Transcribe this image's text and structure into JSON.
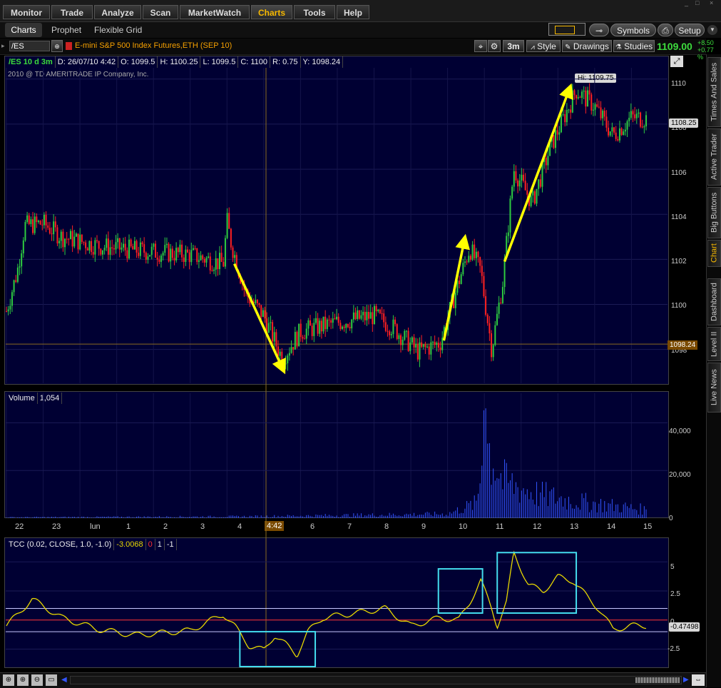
{
  "nav": {
    "tabs": [
      {
        "label": "Monitor"
      },
      {
        "label": "Trade"
      },
      {
        "label": "Analyze"
      },
      {
        "label": "Scan"
      },
      {
        "label": "MarketWatch"
      },
      {
        "label": "Charts"
      },
      {
        "label": "Tools"
      },
      {
        "label": "Help"
      }
    ],
    "active": "Charts"
  },
  "subnav": {
    "tabs": [
      {
        "label": "Charts"
      },
      {
        "label": "Prophet"
      },
      {
        "label": "Flexible Grid"
      }
    ],
    "symbols_label": "Symbols",
    "setup_label": "Setup"
  },
  "chartbar": {
    "symbol": "/ES",
    "description": "E-mini S&P 500 Index Futures,ETH (SEP 10)",
    "aggregation": "3m",
    "style_label": "Style",
    "drawings_label": "Drawings",
    "studies_label": "Studies",
    "last_price": "1109.00",
    "net_change": "+8.50",
    "pct_change": "+0.77 %"
  },
  "price_panel": {
    "header": [
      "/ES 10 d 3m",
      "D: 26/07/10 4:42",
      "O: 1099.5",
      "H: 1100.25",
      "L: 1099.5",
      "C: 1100",
      "R: 0.75",
      "Y: 1098.24"
    ],
    "copyright": "2010 @ TD AMERITRADE IP Company, Inc.",
    "hi_label": "Hi: 1109.75",
    "current_price_label": "1108.25",
    "cursor_price_label": "1098.24",
    "y_ticks": [
      "1110",
      "1108",
      "1106",
      "1104",
      "1102",
      "1100",
      "1098"
    ]
  },
  "volume_panel": {
    "title": "Volume",
    "value": "1,054",
    "y_ticks": [
      "40,000",
      "20,000",
      "0"
    ]
  },
  "time_axis": {
    "labels": [
      "22",
      "23",
      "lun",
      "1",
      "2",
      "3",
      "4",
      "4:42",
      "6",
      "7",
      "8",
      "9",
      "10",
      "11",
      "12",
      "13",
      "14",
      "15"
    ]
  },
  "tcc_panel": {
    "header": [
      "TCC (0.02, CLOSE, 1.0, -1.0)",
      "-3.0068",
      "0",
      "1",
      "-1"
    ],
    "current_label": "-0.47498",
    "y_ticks": [
      "5",
      "2.5",
      "0",
      "-2.5"
    ]
  },
  "sidebar": {
    "tabs": [
      "Times And Sales",
      "Active Trader",
      "Big Buttons",
      "Chart",
      "Dashboard",
      "Level II",
      "Live News"
    ],
    "active": "Chart"
  },
  "colors": {
    "panel_bg": "#000033",
    "accent": "#f6b800",
    "up_bar": "#2ecc40",
    "down_bar": "#ff2020",
    "arrow": "#ffff00",
    "highlight_box": "#44ddee",
    "volume": "#3355ff",
    "tcc_line": "#e8d800",
    "zero_line": "#ff3030",
    "band_line": "#c8c8ff"
  },
  "chart_data": [
    {
      "type": "candlestick",
      "title": "/ES 10 d 3m",
      "ylim": [
        1096.5,
        1110.5
      ],
      "x_labels": [
        "22",
        "23",
        "lun",
        "1",
        "2",
        "3",
        "4",
        "6",
        "7",
        "8",
        "9",
        "10",
        "11",
        "12",
        "13",
        "14",
        "15"
      ],
      "price_path": [
        {
          "t": 0,
          "p": 1099.7
        },
        {
          "t": 0.3,
          "p": 1101.5
        },
        {
          "t": 0.5,
          "p": 1103.5
        },
        {
          "t": 1.0,
          "p": 1103.6
        },
        {
          "t": 1.5,
          "p": 1103.0
        },
        {
          "t": 2.5,
          "p": 1102.6
        },
        {
          "t": 3.5,
          "p": 1102.4
        },
        {
          "t": 5.0,
          "p": 1102.2
        },
        {
          "t": 5.9,
          "p": 1101.8
        },
        {
          "t": 6.0,
          "p": 1103.7
        },
        {
          "t": 6.1,
          "p": 1102.8
        },
        {
          "t": 6.5,
          "p": 1100.5
        },
        {
          "t": 7.0,
          "p": 1099.5
        },
        {
          "t": 7.5,
          "p": 1097.6
        },
        {
          "t": 8.0,
          "p": 1098.8
        },
        {
          "t": 9.0,
          "p": 1099.2
        },
        {
          "t": 10.0,
          "p": 1099.5
        },
        {
          "t": 10.5,
          "p": 1099.0
        },
        {
          "t": 11.2,
          "p": 1097.9
        },
        {
          "t": 11.8,
          "p": 1098.3
        },
        {
          "t": 12.3,
          "p": 1101.0
        },
        {
          "t": 12.6,
          "p": 1102.5
        },
        {
          "t": 12.9,
          "p": 1101.5
        },
        {
          "t": 13.2,
          "p": 1098.0
        },
        {
          "t": 13.5,
          "p": 1101.0
        },
        {
          "t": 13.8,
          "p": 1106.0
        },
        {
          "t": 14.3,
          "p": 1104.5
        },
        {
          "t": 14.8,
          "p": 1107.0
        },
        {
          "t": 15.5,
          "p": 1109.5
        },
        {
          "t": 16.0,
          "p": 1108.8
        },
        {
          "t": 16.5,
          "p": 1107.5
        },
        {
          "t": 17.0,
          "p": 1108.3
        },
        {
          "t": 17.4,
          "p": 1108.25
        }
      ],
      "annotations": {
        "high": "Hi: 1109.75",
        "last": "1108.25",
        "cursor": "1098.24"
      }
    },
    {
      "type": "bar",
      "title": "Volume",
      "ylim": [
        0,
        50000
      ],
      "y_ticks": [
        0,
        20000,
        40000
      ],
      "profile": [
        {
          "t": 0,
          "v": 500
        },
        {
          "t": 6.5,
          "v": 1000
        },
        {
          "t": 12.0,
          "v": 2500
        },
        {
          "t": 12.8,
          "v": 9000
        },
        {
          "t": 13.0,
          "v": 48000
        },
        {
          "t": 13.5,
          "v": 22000
        },
        {
          "t": 14.5,
          "v": 14000
        },
        {
          "t": 15.5,
          "v": 10000
        },
        {
          "t": 17.4,
          "v": 5000
        }
      ]
    },
    {
      "type": "line",
      "title": "TCC (0.02, CLOSE, 1.0, -1.0)",
      "ylim": [
        -4,
        6
      ],
      "y_ticks": [
        5,
        2.5,
        0,
        -2.5
      ],
      "levels": [
        1,
        0,
        -1
      ],
      "series": [
        {
          "values": [
            {
              "t": 0,
              "v": -0.5
            },
            {
              "t": 0.7,
              "v": 1.8
            },
            {
              "t": 1.5,
              "v": 0.2
            },
            {
              "t": 2.5,
              "v": -0.8
            },
            {
              "t": 3.5,
              "v": -1.3
            },
            {
              "t": 5.0,
              "v": -0.9
            },
            {
              "t": 5.9,
              "v": 0.5
            },
            {
              "t": 6.2,
              "v": -0.5
            },
            {
              "t": 6.6,
              "v": -2.2
            },
            {
              "t": 7.0,
              "v": -2.6
            },
            {
              "t": 7.3,
              "v": -1.3
            },
            {
              "t": 7.6,
              "v": -2.1
            },
            {
              "t": 7.9,
              "v": -3.0
            },
            {
              "t": 8.2,
              "v": -1.0
            },
            {
              "t": 8.6,
              "v": 0.2
            },
            {
              "t": 9.5,
              "v": 0.6
            },
            {
              "t": 10.3,
              "v": 1.0
            },
            {
              "t": 11.0,
              "v": -0.5
            },
            {
              "t": 11.8,
              "v": 0.2
            },
            {
              "t": 12.3,
              "v": 0.0
            },
            {
              "t": 12.6,
              "v": 1.5
            },
            {
              "t": 12.9,
              "v": 3.4
            },
            {
              "t": 13.2,
              "v": 1.0
            },
            {
              "t": 13.35,
              "v": -0.5
            },
            {
              "t": 13.6,
              "v": 1.5
            },
            {
              "t": 13.8,
              "v": 5.8
            },
            {
              "t": 14.2,
              "v": 3.0
            },
            {
              "t": 14.6,
              "v": 2.5
            },
            {
              "t": 15.0,
              "v": 3.7
            },
            {
              "t": 15.4,
              "v": 3.4
            },
            {
              "t": 15.8,
              "v": 2.0
            },
            {
              "t": 16.1,
              "v": 1.0
            },
            {
              "t": 16.5,
              "v": -0.8
            },
            {
              "t": 17.0,
              "v": -0.5
            },
            {
              "t": 17.4,
              "v": -0.47
            }
          ]
        }
      ]
    }
  ]
}
